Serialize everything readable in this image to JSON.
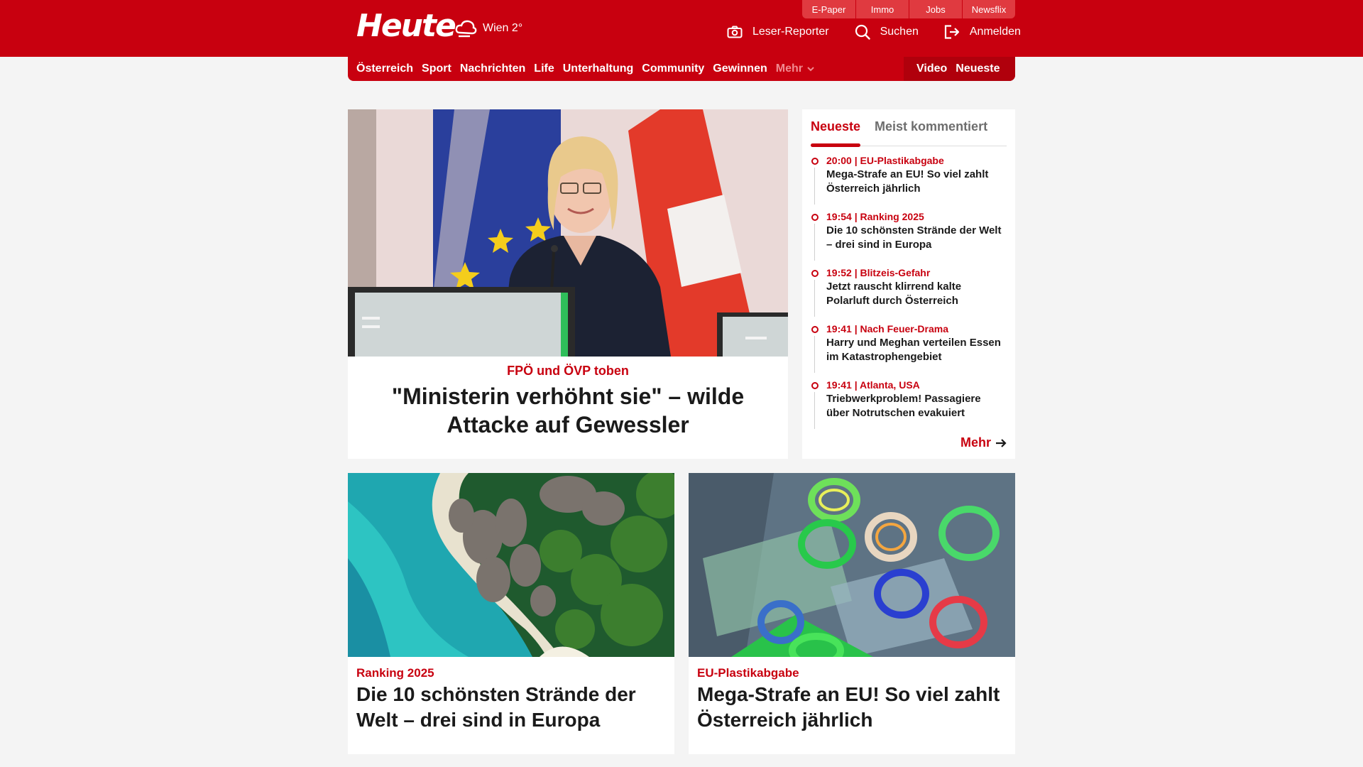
{
  "header": {
    "logo": "Heute",
    "weather": "Wien 2°",
    "utility_links": [
      "E-Paper",
      "Immo",
      "Jobs",
      "Newsflix"
    ],
    "actions": {
      "reporter": "Leser-Reporter",
      "search": "Suchen",
      "login": "Anmelden"
    }
  },
  "nav": {
    "items": [
      "Österreich",
      "Sport",
      "Nachrichten",
      "Life",
      "Unterhaltung",
      "Community",
      "Gewinnen"
    ],
    "more": "Mehr",
    "right": [
      "Video",
      "Neueste"
    ]
  },
  "hero": {
    "kicker": "FPÖ und ÖVP toben",
    "title": "\"Ministerin verhöhnt sie\" – wilde Attacke auf Gewessler"
  },
  "sidebar": {
    "tabs": [
      "Neueste",
      "Meist kommentiert"
    ],
    "items": [
      {
        "meta": "20:00 | EU-Plastikabgabe",
        "title": "Mega-Strafe an EU! So viel zahlt Österreich jährlich"
      },
      {
        "meta": "19:54 | Ranking 2025",
        "title": "Die 10 schönsten Strände der Welt – drei sind in Europa"
      },
      {
        "meta": "19:52 | Blitzeis-Gefahr",
        "title": "Jetzt rauscht klirrend kalte Polarluft durch Österreich"
      },
      {
        "meta": "19:41 | Nach Feuer-Drama",
        "title": "Harry und Meghan verteilen Essen im Katastrophengebiet"
      },
      {
        "meta": "19:41 | Atlanta, USA",
        "title": "Triebwerkproblem! Passagiere über Notrutschen evakuiert"
      }
    ],
    "more": "Mehr"
  },
  "cards": [
    {
      "kicker": "Ranking 2025",
      "title": "Die 10 schönsten Strände der Welt – drei sind in Europa"
    },
    {
      "kicker": "EU-Plastikabgabe",
      "title": "Mega-Strafe an EU! So viel zahlt Österreich jährlich"
    }
  ],
  "colors": {
    "brand": "#c8000f",
    "background": "#f4f4f4"
  }
}
